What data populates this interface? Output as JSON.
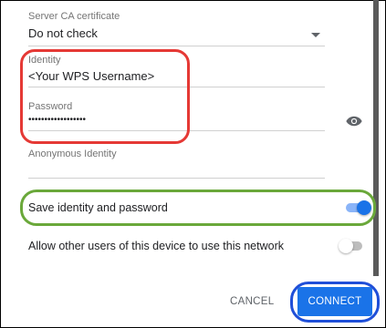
{
  "server_ca": {
    "label": "Server CA certificate",
    "value": "Do not check"
  },
  "identity": {
    "label": "Identity",
    "value": "<Your WPS Username>"
  },
  "password": {
    "label": "Password",
    "value": "••••••••••••••••••"
  },
  "anonymous_identity": {
    "label": "Anonymous Identity",
    "value": ""
  },
  "save_identity": {
    "label": "Save identity and password",
    "checked": true
  },
  "allow_other_users": {
    "label": "Allow other users of this device to use this network",
    "checked": false
  },
  "actions": {
    "cancel_label": "CANCEL",
    "connect_label": "CONNECT"
  },
  "colors": {
    "accent": "#1a73e8",
    "highlight_red": "#e53935",
    "highlight_green": "#6aa83a",
    "highlight_blue": "#1f4fd8"
  },
  "icons": {
    "password_visibility": "eye-icon",
    "dropdown": "chevron-down-icon"
  }
}
